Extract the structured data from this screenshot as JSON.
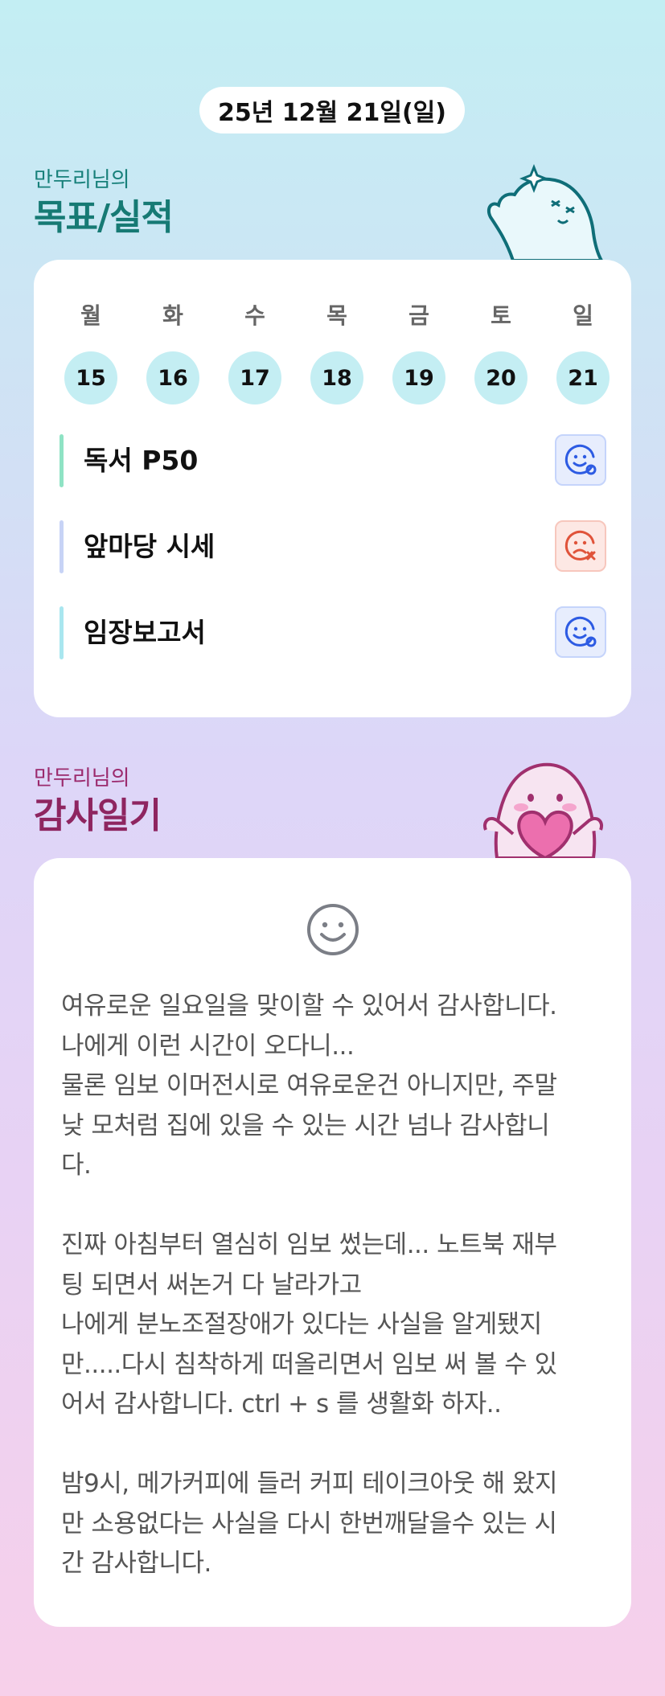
{
  "header": {
    "date": "25년 12월 21일(일)"
  },
  "goals_section": {
    "subtitle": "만두리님의",
    "title": "목표/실적",
    "week": [
      {
        "day": "월",
        "date": "15"
      },
      {
        "day": "화",
        "date": "16"
      },
      {
        "day": "수",
        "date": "17"
      },
      {
        "day": "목",
        "date": "18"
      },
      {
        "day": "금",
        "date": "19"
      },
      {
        "day": "토",
        "date": "20"
      },
      {
        "day": "일",
        "date": "21"
      }
    ],
    "goals": [
      {
        "label": "독서 P50",
        "status": "achieved",
        "bar_color": "#8fe3c4"
      },
      {
        "label": "앞마당 시세",
        "status": "not-achieved",
        "bar_color": "#c7d3f6"
      },
      {
        "label": "임장보고서",
        "status": "achieved",
        "bar_color": "#a9e6ef"
      }
    ]
  },
  "thanks_section": {
    "subtitle": "만두리님의",
    "title": "감사일기",
    "mood_icon": "smile-icon",
    "body": "여유로운 일요일을 맞이할 수 있어서 감사합니다.\n나에게 이런 시간이 오다니...\n물론 임보 이머전시로 여유로운건 아니지만, 주말\n낮 모처럼 집에 있을 수 있는 시간 넘나 감사합니\n다.\n\n진짜 아침부터 열심히 임보 썼는데... 노트북 재부\n팅 되면서 써논거 다 날라가고\n나에게 분노조절장애가 있다는 사실을 알게됐지\n만.....다시 침착하게 떠올리면서 임보 써 볼 수 있\n어서 감사합니다. ctrl + s 를 생활화 하자..\n\n밤9시, 메가커피에 들러 커피 테이크아웃 해 왔지\n만 소용없다는 사실을 다시 한번깨달을수 있는 시\n간 감사합니다."
  },
  "colors": {
    "goal_accent": "#167a74",
    "thanks_accent": "#8e2560",
    "achieved": "#2d5be3",
    "not_achieved": "#e0533a"
  }
}
